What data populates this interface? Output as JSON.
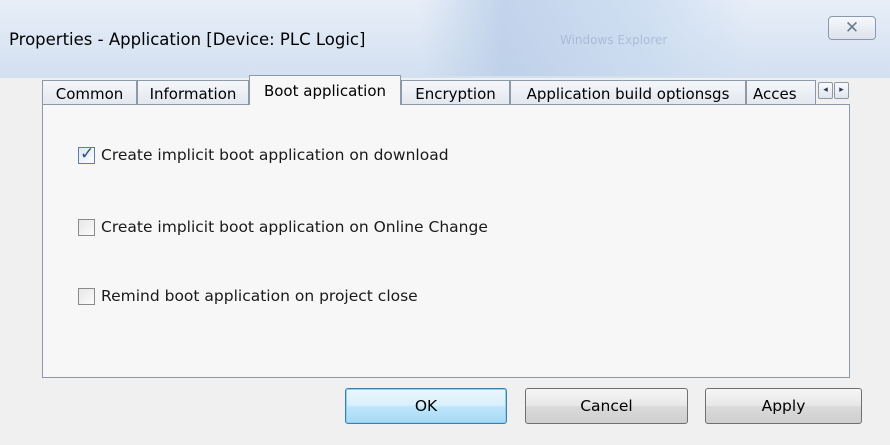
{
  "window": {
    "title": "Properties - Application [Device: PLC Logic]",
    "background_title_text": "Windows Explorer",
    "close_icon": "close-x-icon"
  },
  "tabs": [
    {
      "label": "Common",
      "active": false
    },
    {
      "label": "Information",
      "active": false
    },
    {
      "label": "Boot application",
      "active": true
    },
    {
      "label": "Encryption",
      "active": false
    },
    {
      "label": "Application build optionsgs",
      "active": false
    },
    {
      "label": "Acces",
      "active": false
    }
  ],
  "tab_scroll": {
    "left_icon": "scroll-left-icon",
    "right_icon": "scroll-right-icon",
    "left_glyph": "◂",
    "right_glyph": "▸"
  },
  "options": [
    {
      "label": "Create implicit boot application on download",
      "checked": true
    },
    {
      "label": "Create implicit boot application on Online Change",
      "checked": false
    },
    {
      "label": "Remind boot application on project close",
      "checked": false
    }
  ],
  "buttons": {
    "ok": "OK",
    "cancel": "Cancel",
    "apply": "Apply"
  },
  "colors": {
    "default_button_border": "#3c7fb1",
    "checkmark": "#2b4f8a"
  }
}
